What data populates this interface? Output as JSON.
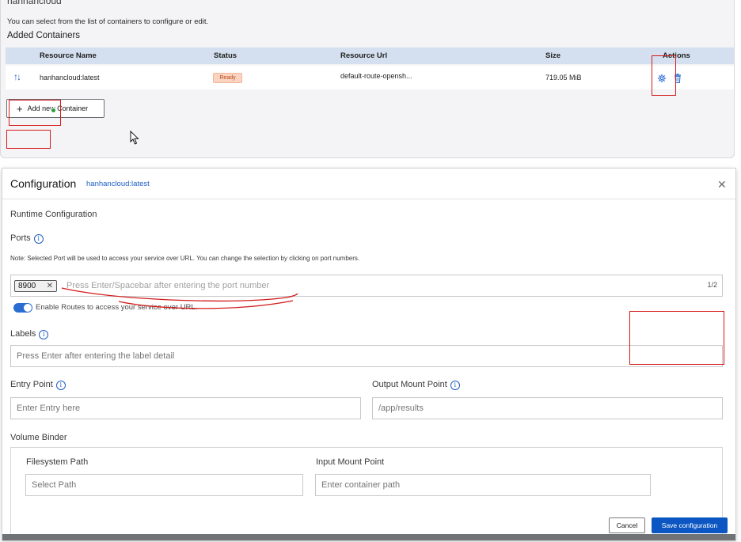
{
  "top": {
    "heading_cut": "hanhancloud",
    "description": "You can select from the list of containers to configure or edit.",
    "added_title": "Added Containers",
    "columns": [
      "Resource Name",
      "Status",
      "Resource Url",
      "Size",
      "Actions"
    ],
    "row": {
      "name": "hanhancloud:latest",
      "status": "Ready",
      "url": "default-route-opensh...",
      "size": "719.05 MiB"
    },
    "add_button_label": "Add new Container"
  },
  "modal": {
    "title": "Configuration",
    "subtitle": "hanhancloud:latest",
    "runtime_title": "Runtime Configuration",
    "ports_label": "Ports",
    "note": "Note:  Selected Port will be used to access your service over URL. You can change the selection by clicking on port numbers.",
    "port_chip": "8900",
    "ports_placeholder": "Press Enter/Spacebar after entering the port number",
    "ports_count": "1/2",
    "toggle_label": "Enable Routes to access your service over URL.",
    "labels_label": "Labels",
    "labels_placeholder": "Press Enter after entering the label detail",
    "entry_label": "Entry Point",
    "entry_placeholder": "Enter Entry here",
    "output_label": "Output Mount Point",
    "output_value": "/app/results",
    "volume_title": "Volume Binder",
    "fs_label": "Filesystem Path",
    "fs_placeholder": "Select Path",
    "input_mount_label": "Input Mount Point",
    "input_mount_placeholder": "Enter container path",
    "cancel_label": "Cancel",
    "save_label": "Save configuration"
  },
  "colors": {
    "accent": "#0b56c2",
    "highlight": "#d41a1a",
    "status_ready_bg": "#fbd3c1"
  }
}
